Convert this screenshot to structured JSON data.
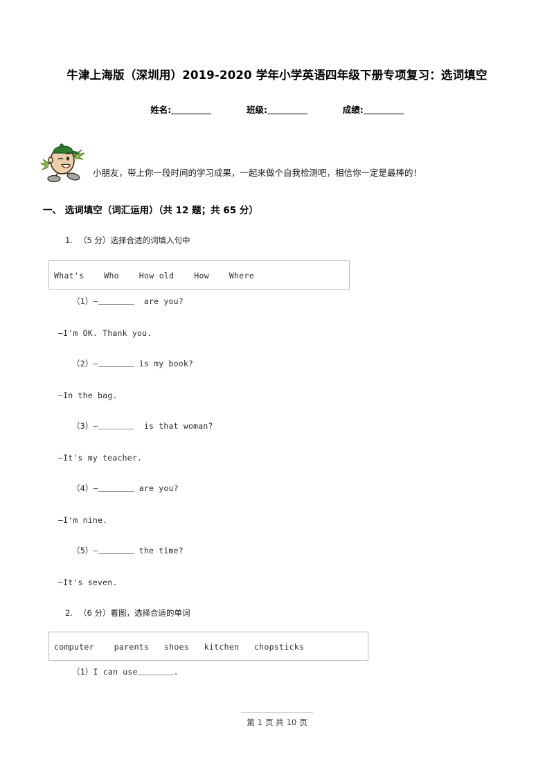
{
  "document": {
    "title": "牛津上海版（深圳用）2019-2020 学年小学英语四年级下册专项复习：选词填空",
    "student_fields": {
      "name_label": "姓名:",
      "class_label": "班级:",
      "score_label": "成绩:"
    },
    "slogan": "小朋友，带上你一段时间的学习成果，一起来做个自我检测吧，相信你一定是最棒的！",
    "mascot": {
      "name": "cartoon-student-mascot",
      "cap_color": "#2e7d32",
      "face_color": "#e8c9a0",
      "outline_color": "#3a2a1a",
      "shoe_color": "#9e9e9e",
      "hand_color": "#7cb342"
    }
  },
  "section": {
    "label": "一、",
    "title": "选词填空（词汇运用）",
    "meta": "（共 12 题；共 65 分）",
    "full": "一、 选词填空（词汇运用）（共 12 题；共 65 分）"
  },
  "questions": [
    {
      "number": "1.",
      "stem": "（5 分）选择合适的词填入句中",
      "wordbank": "What's    Who    How old    How    Where",
      "items": [
        {
          "label": "（1）—",
          "text_before": "",
          "text_after": "  are you?"
        },
        {
          "label": "—I'm OK. Thank you.",
          "type": "answer"
        },
        {
          "label": "（2）—",
          "text_before": "",
          "text_after": " is my book?"
        },
        {
          "label": "—In the bag.",
          "type": "answer"
        },
        {
          "label": "（3）—",
          "text_before": "",
          "text_after": "  is that woman?"
        },
        {
          "label": "—It's my teacher.",
          "type": "answer"
        },
        {
          "label": "（4）—",
          "text_before": "",
          "text_after": " are you?"
        },
        {
          "label": "—I'm nine.",
          "type": "answer"
        },
        {
          "label": "（5）—",
          "text_before": "",
          "text_after": " the time?"
        },
        {
          "label": "—It's seven.",
          "type": "answer"
        }
      ]
    },
    {
      "number": "2.",
      "stem": "（6 分）看图，选择合适的单词",
      "wordbank": "computer    parents   shoes   kitchen   chopsticks",
      "items": [
        {
          "label": "（1）I can use",
          "text_after": "."
        }
      ]
    }
  ],
  "footer": {
    "prefix": "第",
    "page": "1",
    "middle": "页 共",
    "total": "10",
    "suffix": "页"
  }
}
